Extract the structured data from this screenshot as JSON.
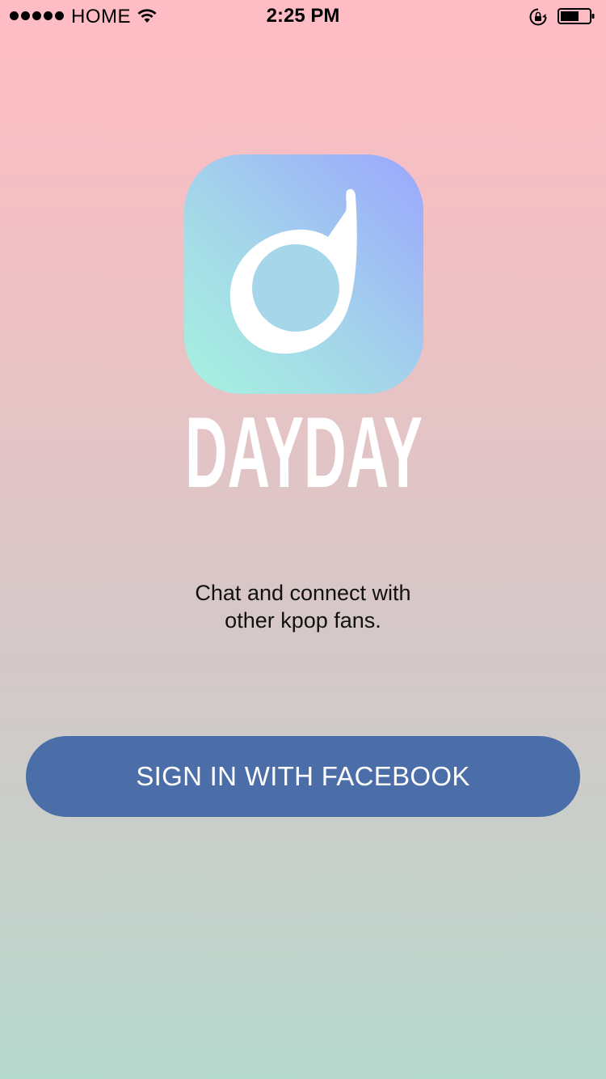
{
  "status_bar": {
    "carrier": "HOME",
    "time": "2:25 PM",
    "signal_icon": "signal-dots-icon",
    "wifi_icon": "wifi-icon",
    "rotation_lock_icon": "rotation-lock-icon",
    "battery_icon": "battery-icon"
  },
  "app": {
    "name": "DAYDAY",
    "logo_icon": "music-note-logo-icon",
    "tagline_line1": "Chat and connect with",
    "tagline_line2": "other kpop fans."
  },
  "sign_in": {
    "facebook_label": "SIGN IN WITH FACEBOOK"
  },
  "colors": {
    "background_top": "#ffbcc4",
    "background_bottom": "#b5d8cd",
    "button": "#4b6ea9",
    "logo_gradient_start": "#a6f3df",
    "logo_gradient_end": "#9aa6ff"
  }
}
